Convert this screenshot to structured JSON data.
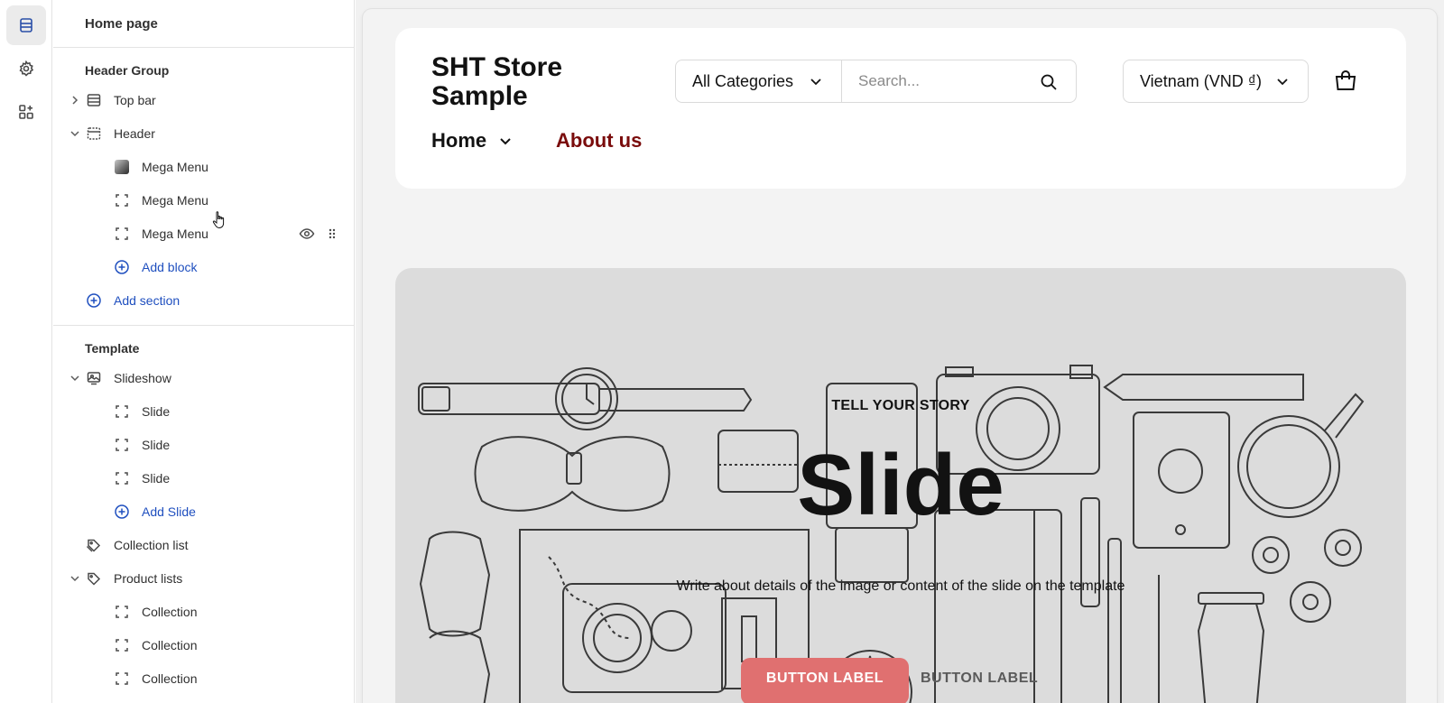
{
  "sidebar": {
    "title": "Home page",
    "header_group": {
      "heading": "Header Group",
      "items": [
        {
          "label": "Top bar"
        },
        {
          "label": "Header"
        }
      ],
      "header_blocks": [
        {
          "label": "Mega Menu"
        },
        {
          "label": "Mega Menu"
        },
        {
          "label": "Mega Menu"
        }
      ],
      "add_block": "Add block",
      "add_section": "Add section"
    },
    "template": {
      "heading": "Template",
      "slideshow": "Slideshow",
      "slides": [
        {
          "label": "Slide"
        },
        {
          "label": "Slide"
        },
        {
          "label": "Slide"
        }
      ],
      "add_slide": "Add Slide",
      "collection_list": "Collection list",
      "product_lists": "Product lists",
      "collections": [
        {
          "label": "Collection"
        },
        {
          "label": "Collection"
        },
        {
          "label": "Collection"
        }
      ]
    }
  },
  "store": {
    "name": "SHT Store Sample",
    "category_select": "All Categories",
    "search_placeholder": "Search...",
    "currency": "Vietnam (VND ₫)",
    "nav": {
      "home": "Home",
      "about": "About us"
    }
  },
  "slide": {
    "subheading": "TELL YOUR STORY",
    "heading": "Slide",
    "text": "Write about details of the image or content of the slide on the template",
    "button1": "BUTTON LABEL",
    "button2": "BUTTON LABEL"
  },
  "colors": {
    "accent_link": "#1f4fbf",
    "about_us": "#7a0c0c",
    "button_primary": "#e07070"
  }
}
